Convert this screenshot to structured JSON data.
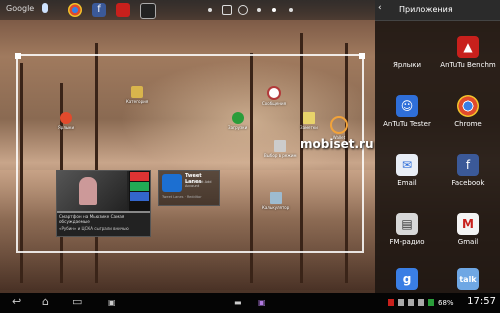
{
  "topbar": {
    "google_label": "Google",
    "icons": [
      "microphone-icon",
      "chrome-icon",
      "facebook-icon",
      "antutu-icon",
      "camera-icon"
    ]
  },
  "desktop": {
    "items": [
      {
        "label": "Ярлыки",
        "icon": "settings-icon",
        "color": "#e24a2c"
      },
      {
        "label": "Категория",
        "icon": "film-icon",
        "color": "#d9b54c"
      },
      {
        "label": "Загрузки",
        "icon": "download-icon",
        "color": "#2a9d3a"
      },
      {
        "label": "Сообщения",
        "icon": "message-icon",
        "color": "#b23a3a"
      },
      {
        "label": "Заметки",
        "icon": "note-icon",
        "color": "#e8d36a"
      },
      {
        "label": "Wallet",
        "icon": "wallet-icon",
        "color": "#f2a33a"
      },
      {
        "label": "Выбор в режим",
        "icon": "select-icon",
        "color": "#cccccc"
      },
      {
        "label": "Калькулятор",
        "icon": "calculator-icon",
        "color": "#9dbbd0"
      }
    ],
    "video_widget": {
      "caption": "Смартфон на Мьюзике Самая обсуждаемые",
      "comment": "«Рубин» и ЦСКА сыграли вничью"
    },
    "tweet_widget": {
      "title": "Tweet Lanes",
      "subtitle": "Post Tweet Add Account",
      "footer": "Tweet Lanes · Redditor"
    }
  },
  "watermark": "mobiset.ru",
  "drawer": {
    "title": "Приложения",
    "apps": [
      {
        "label": "Ярлыки",
        "icon": "shortcuts-icon",
        "color": "#8e8e8e"
      },
      {
        "label": "AnTuTu Benchm",
        "icon": "antutu-benchmark-icon",
        "color": "#c8201c"
      },
      {
        "label": "AnTuTu Tester",
        "icon": "antutu-tester-icon",
        "color": "#2f6fd9"
      },
      {
        "label": "Chrome",
        "icon": "chrome-icon",
        "color": "#e04a2c"
      },
      {
        "label": "Email",
        "icon": "email-icon",
        "color": "#e9eef6"
      },
      {
        "label": "Facebook",
        "icon": "facebook-icon",
        "color": "#3b5998"
      },
      {
        "label": "FM-радио",
        "icon": "fm-radio-icon",
        "color": "#d8d8d8"
      },
      {
        "label": "Gmail",
        "icon": "gmail-icon",
        "color": "#f4f4f4"
      },
      {
        "label": "",
        "icon": "google-icon",
        "color": "#3a7ee4"
      },
      {
        "label": "",
        "icon": "talk-icon",
        "color": "#6fa7e4"
      }
    ]
  },
  "statusbar": {
    "battery": "68%",
    "time": "17:57"
  }
}
